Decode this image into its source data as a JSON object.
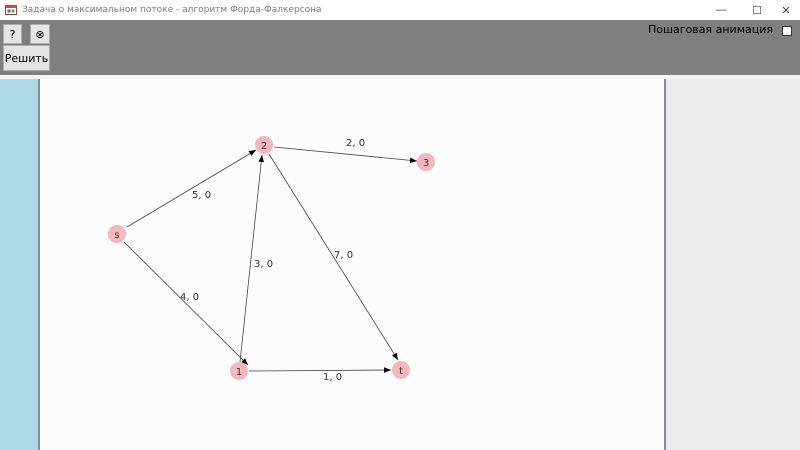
{
  "window": {
    "title": "Задача о максимальном потоке - алгоритм Форда-Фалкерсона",
    "minimize_glyph": "—",
    "maximize_glyph": "☐",
    "close_glyph": "✕"
  },
  "toolbar": {
    "help_label": "?",
    "clear_label": "⊗",
    "solve_label": "Решить",
    "animation_label": "Пошаговая анимация",
    "animation_checked": false
  },
  "graph": {
    "node_color": "#f7b5be",
    "edge_color": "#000000",
    "nodes": [
      {
        "id": "s",
        "label": "s"
      },
      {
        "id": "n2",
        "label": "2"
      },
      {
        "id": "n3",
        "label": "3"
      },
      {
        "id": "n1",
        "label": "1"
      },
      {
        "id": "t",
        "label": "t"
      }
    ],
    "edges": [
      {
        "from": "s",
        "to": "n2",
        "label": "5, 0"
      },
      {
        "from": "s",
        "to": "n1",
        "label": "4, 0"
      },
      {
        "from": "n2",
        "to": "n3",
        "label": "2, 0"
      },
      {
        "from": "n1",
        "to": "n2",
        "label": "3, 0"
      },
      {
        "from": "n2",
        "to": "t",
        "label": "7, 0"
      },
      {
        "from": "n1",
        "to": "t",
        "label": "1, 0"
      }
    ]
  }
}
